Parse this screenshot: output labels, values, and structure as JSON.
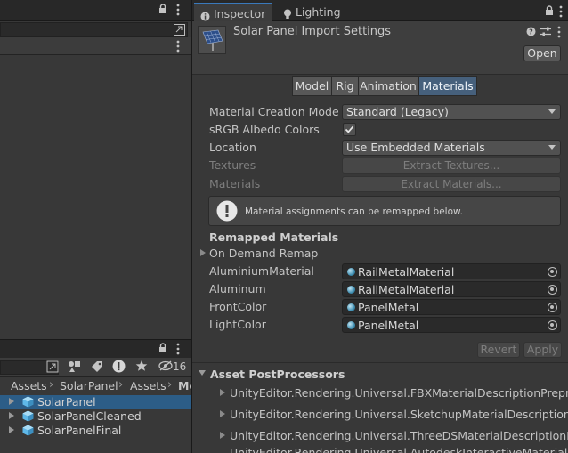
{
  "inspector": {
    "tabs": [
      {
        "label": "Inspector",
        "icon": "info-icon"
      },
      {
        "label": "Lighting",
        "icon": "lightbulb-icon"
      }
    ],
    "title": "Solar Panel Import Settings",
    "open_label": "Open",
    "segments": [
      "Model",
      "Rig",
      "Animation",
      "Materials"
    ],
    "active_segment": "Materials",
    "fields": {
      "material_creation_mode": {
        "label": "Material Creation Mode",
        "value": "Standard (Legacy)"
      },
      "srgb_albedo": {
        "label": "sRGB Albedo Colors",
        "checked": true
      },
      "location": {
        "label": "Location",
        "value": "Use Embedded Materials"
      },
      "textures": {
        "label": "Textures",
        "button": "Extract Textures..."
      },
      "materials": {
        "label": "Materials",
        "button": "Extract Materials..."
      }
    },
    "help_message": "Material assignments can be remapped below.",
    "remapped_heading": "Remapped Materials",
    "on_demand_remap": "On Demand Remap",
    "remap_rows": [
      {
        "label": "AluminiumMaterial",
        "value": "RailMetalMaterial"
      },
      {
        "label": "Aluminum",
        "value": "RailMetalMaterial"
      },
      {
        "label": "FrontColor",
        "value": "PanelMetal"
      },
      {
        "label": "LightColor",
        "value": "PanelMetal"
      }
    ],
    "revert_label": "Revert",
    "apply_label": "Apply",
    "postprocessors_heading": "Asset PostProcessors",
    "postprocessors": [
      "UnityEditor.Rendering.Universal.FBXMaterialDescriptionPreprocessor",
      "UnityEditor.Rendering.Universal.SketchupMaterialDescriptionPreprocessor",
      "UnityEditor.Rendering.Universal.ThreeDSMaterialDescriptionPreprocessor",
      "UnityEditor.Rendering.Universal.AutodeskInteractiveMaterialImport"
    ]
  },
  "project": {
    "hidden_count": "16",
    "breadcrumb": [
      "Assets",
      "SolarPanel",
      "Assets",
      "Mo"
    ],
    "files": [
      {
        "name": "SolarPanel",
        "selected": true
      },
      {
        "name": "SolarPanelCleaned",
        "selected": false
      },
      {
        "name": "SolarPanelFinal",
        "selected": false
      }
    ]
  },
  "colors": {
    "accent": "#3a79bb",
    "selection": "#2c5d87",
    "active_segment": "#46607c",
    "panel_bg": "#383838"
  }
}
